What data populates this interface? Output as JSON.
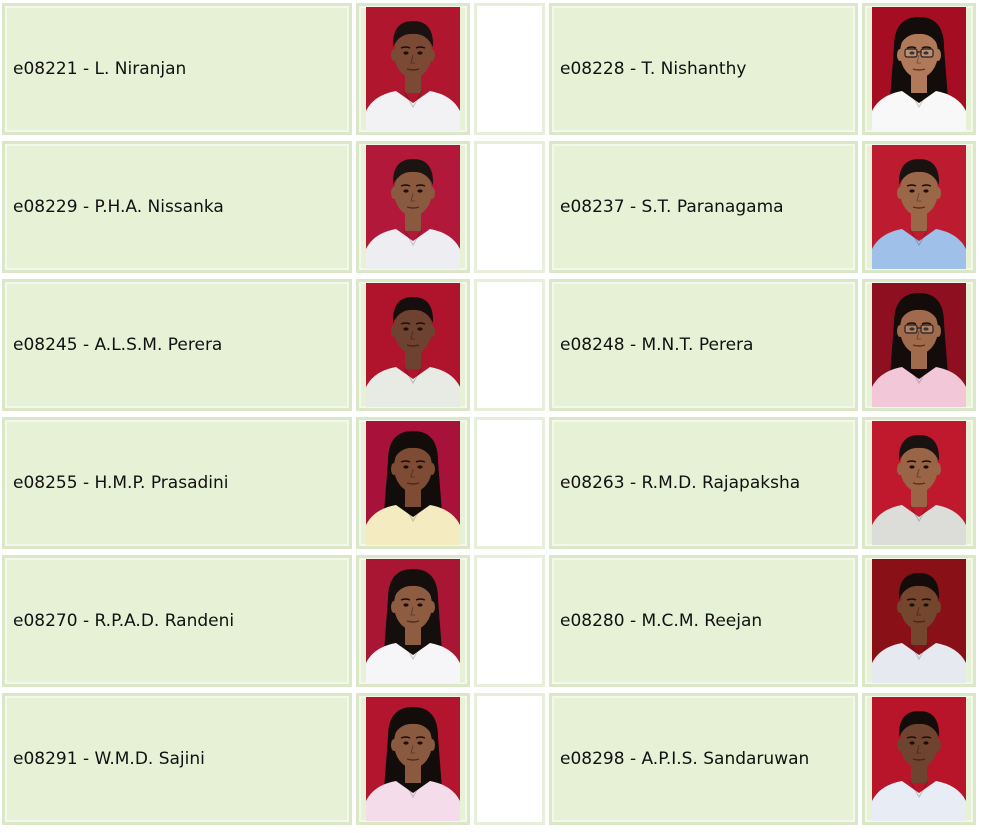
{
  "students": [
    {
      "left": {
        "label": "e08221 - L. Niranjan",
        "bg": "#b0162e",
        "shirt": "#f2f2f4",
        "hair": "#1a1210",
        "skin": "#7a4a34",
        "glasses": false,
        "long_hair": false
      },
      "right": {
        "label": "e08228 - T. Nishanthy",
        "bg": "#a50e22",
        "shirt": "#f8f8f8",
        "hair": "#120c0a",
        "skin": "#b07a5a",
        "glasses": true,
        "long_hair": true
      }
    },
    {
      "left": {
        "label": "e08229 - P.H.A. Nissanka",
        "bg": "#b2183a",
        "shirt": "#eeeef2",
        "hair": "#1c1410",
        "skin": "#8a5a40",
        "glasses": false,
        "long_hair": false
      },
      "right": {
        "label": "e08237 - S.T. Paranagama",
        "bg": "#bd1c30",
        "shirt": "#9fc0e8",
        "hair": "#1a1210",
        "skin": "#9a6848",
        "glasses": false,
        "long_hair": false
      }
    },
    {
      "left": {
        "label": "e08245 - A.L.S.M. Perera",
        "bg": "#b0142c",
        "shirt": "#e8eae4",
        "hair": "#160e0c",
        "skin": "#6e4230",
        "glasses": false,
        "long_hair": false
      },
      "right": {
        "label": "e08248 - M.N.T. Perera",
        "bg": "#8e1020",
        "shirt": "#f2c8d8",
        "hair": "#140c0a",
        "skin": "#a06a4c",
        "glasses": true,
        "long_hair": true
      }
    },
    {
      "left": {
        "label": "e08255 - H.M.P. Prasadini",
        "bg": "#a8123a",
        "shirt": "#f4ecc0",
        "hair": "#120c0a",
        "skin": "#7e4c34",
        "glasses": false,
        "long_hair": true
      },
      "right": {
        "label": "e08263 - R.M.D. Rajapaksha",
        "bg": "#c0182c",
        "shirt": "#dcdcd8",
        "hair": "#1a1210",
        "skin": "#9a6446",
        "glasses": false,
        "long_hair": false
      }
    },
    {
      "left": {
        "label": "e08270 - R.P.A.D. Randeni",
        "bg": "#a81634",
        "shirt": "#f6f6f8",
        "hair": "#140e0c",
        "skin": "#8e5c40",
        "glasses": false,
        "long_hair": true
      },
      "right": {
        "label": "e08280 - M.C.M. Reejan",
        "bg": "#8a1018",
        "shirt": "#e6eaf0",
        "hair": "#140c0a",
        "skin": "#74462e",
        "glasses": false,
        "long_hair": false
      }
    },
    {
      "left": {
        "label": "e08291 - W.M.D. Sajini",
        "bg": "#b3142e",
        "shirt": "#f4dcea",
        "hair": "#120c0a",
        "skin": "#8a5a40",
        "glasses": false,
        "long_hair": true
      },
      "right": {
        "label": "e08298 - A.P.I.S. Sandaruwan",
        "bg": "#b8142a",
        "shirt": "#e8ecf4",
        "hair": "#120c0a",
        "skin": "#6e4430",
        "glasses": false,
        "long_hair": false
      }
    }
  ]
}
